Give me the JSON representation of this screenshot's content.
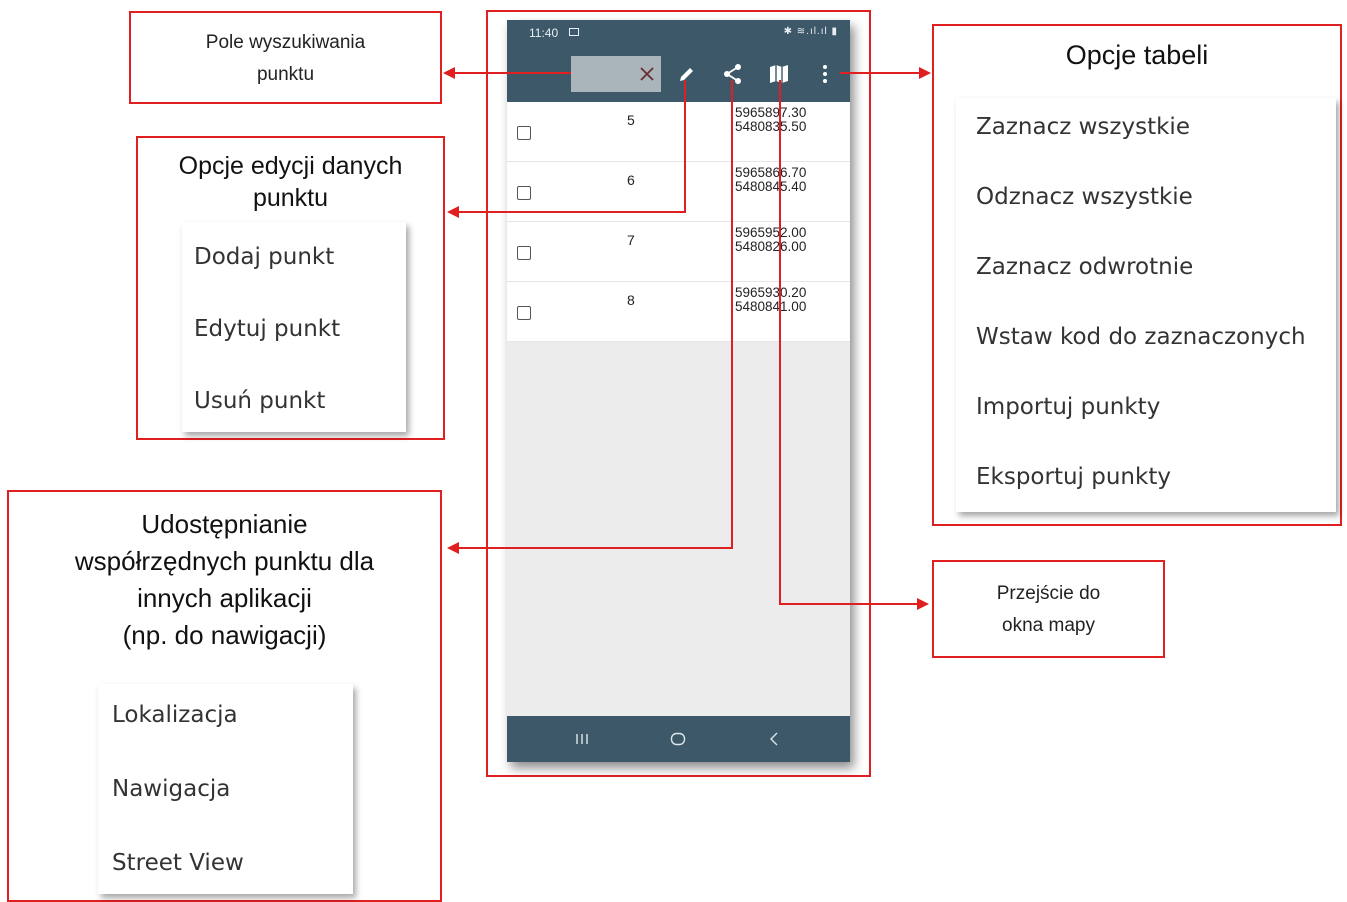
{
  "callouts": {
    "search": "Pole wyszukiwania punktu",
    "search_line1": "Pole wyszukiwania",
    "search_line2": "punktu",
    "edit_title_line1": "Opcje edycji danych",
    "edit_title_line2": "punktu",
    "edit_menu": [
      "Dodaj punkt",
      "Edytuj punkt",
      "Usuń punkt"
    ],
    "share_title_lines": [
      "Udostępnianie",
      "współrzędnych punktu dla",
      "innych aplikacji",
      "(np. do nawigacji)"
    ],
    "share_menu": [
      "Lokalizacja",
      "Nawigacja",
      "Street View"
    ],
    "table_title": "Opcje tabeli",
    "table_menu": [
      "Zaznacz wszystkie",
      "Odznacz wszystkie",
      "Zaznacz odwrotnie",
      "Wstaw kod do zaznaczonych",
      "Importuj punkty",
      "Eksportuj punkty"
    ],
    "map_line1": "Przejście do",
    "map_line2": "okna mapy"
  },
  "phone": {
    "time": "11:40",
    "search_clear_icon": "close-icon",
    "toolbar_icons": [
      "edit-icon",
      "share-icon",
      "map-icon",
      "more-vert-icon"
    ],
    "rows": [
      {
        "num": "5",
        "x": "5965897.30",
        "y": "5480835.50"
      },
      {
        "num": "6",
        "x": "5965866.70",
        "y": "5480845.40"
      },
      {
        "num": "7",
        "x": "5965952.00",
        "y": "5480826.00"
      },
      {
        "num": "8",
        "x": "5965930.20",
        "y": "5480841.00"
      }
    ],
    "nav_icons": [
      "recents-icon",
      "home-icon",
      "back-icon"
    ]
  },
  "colors": {
    "callout_border": "#e02020",
    "toolbar": "#3d5868",
    "search_field": "#aab4bb"
  }
}
